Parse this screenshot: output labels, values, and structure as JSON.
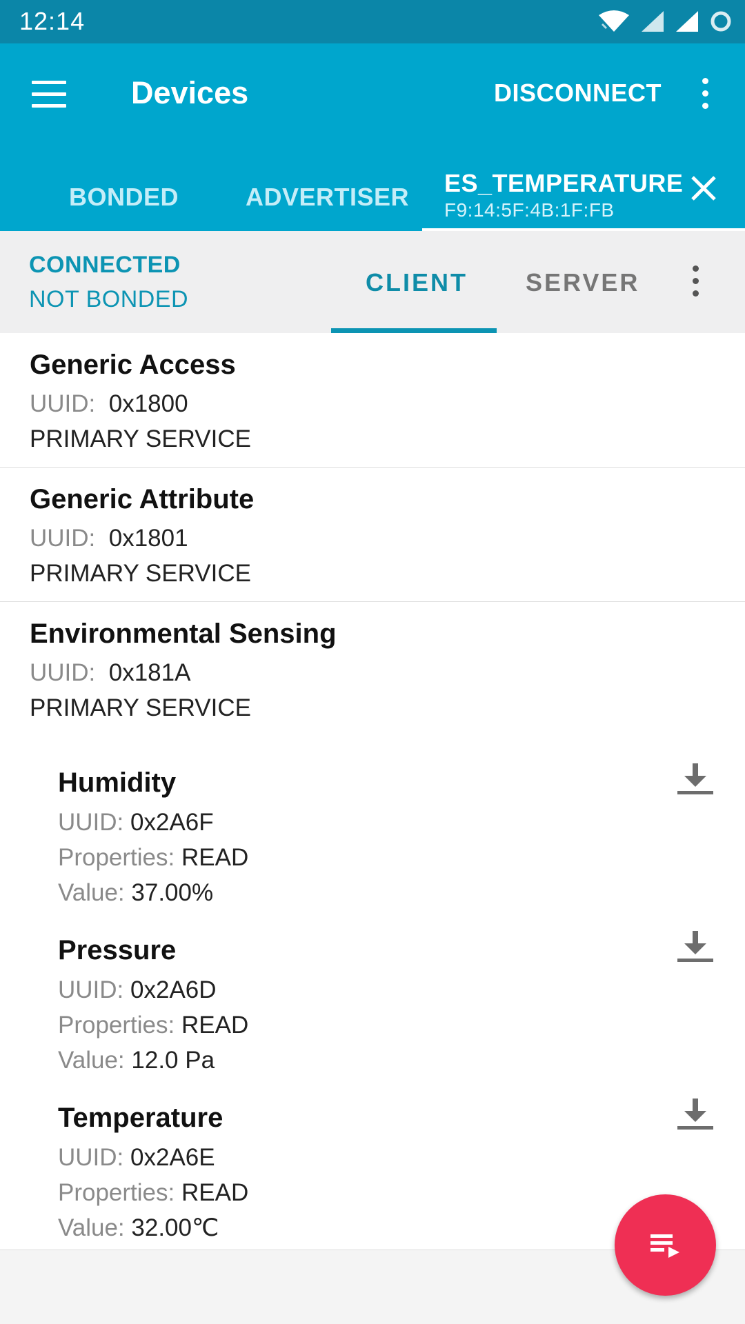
{
  "status_bar": {
    "time": "12:14",
    "icons": [
      "wifi-icon",
      "cell-signal-icon",
      "cell-signal-icon",
      "sync-icon"
    ]
  },
  "app_bar": {
    "title": "Devices",
    "disconnect_label": "DISCONNECT",
    "tabs": [
      {
        "label": "BONDED"
      },
      {
        "label": "ADVERTISER"
      },
      {
        "label": "ES_TEMPERATURE",
        "address": "F9:14:5F:4B:1F:FB",
        "selected": true
      }
    ]
  },
  "connection": {
    "state": "CONNECTED",
    "bond": "NOT BONDED",
    "tabs": [
      {
        "label": "CLIENT",
        "selected": true
      },
      {
        "label": "SERVER"
      }
    ]
  },
  "services": [
    {
      "name": "Generic Access",
      "uuid_label": "UUID:",
      "uuid": "0x1800",
      "type": "PRIMARY SERVICE"
    },
    {
      "name": "Generic Attribute",
      "uuid_label": "UUID:",
      "uuid": "0x1801",
      "type": "PRIMARY SERVICE"
    },
    {
      "name": "Environmental Sensing",
      "uuid_label": "UUID:",
      "uuid": "0x181A",
      "type": "PRIMARY SERVICE",
      "characteristics": [
        {
          "name": "Humidity",
          "uuid_label": "UUID:",
          "uuid": "0x2A6F",
          "properties_label": "Properties:",
          "properties": "READ",
          "value_label": "Value:",
          "value": "37.00%"
        },
        {
          "name": "Pressure",
          "uuid_label": "UUID:",
          "uuid": "0x2A6D",
          "properties_label": "Properties:",
          "properties": "READ",
          "value_label": "Value:",
          "value": "12.0 Pa"
        },
        {
          "name": "Temperature",
          "uuid_label": "UUID:",
          "uuid": "0x2A6E",
          "properties_label": "Properties:",
          "properties": "READ",
          "value_label": "Value:",
          "value": "32.00℃"
        }
      ]
    }
  ],
  "colors": {
    "status_bar": "#0b86a8",
    "app_bar": "#00a6cd",
    "accent": "#0c94b3",
    "fab": "#ef2f54"
  }
}
